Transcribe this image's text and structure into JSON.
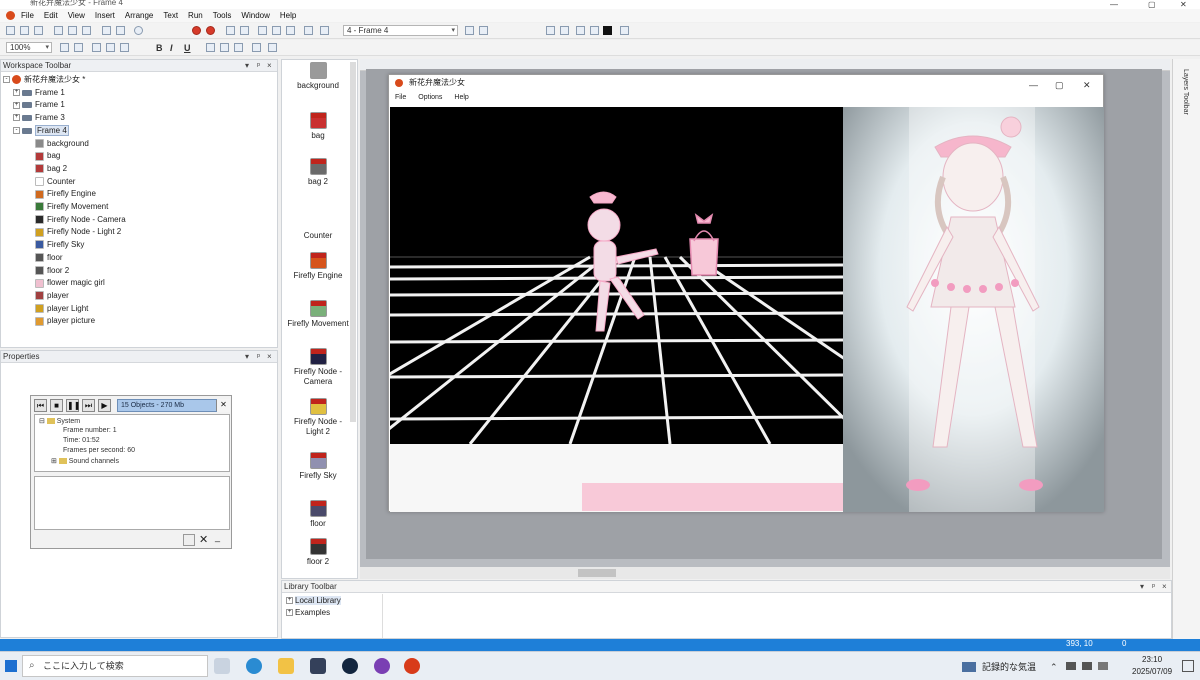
{
  "window": {
    "title": "新花弁魔法少女 - Frame 4"
  },
  "menu": [
    "File",
    "Edit",
    "View",
    "Insert",
    "Arrange",
    "Text",
    "Run",
    "Tools",
    "Window",
    "Help"
  ],
  "toolbar": {
    "frame_select": "4 - Frame 4",
    "zoom_select": "100%",
    "bold": "B",
    "italic": "I",
    "underline": "U"
  },
  "workspace": {
    "title": "Workspace Toolbar",
    "app_name": "新花弁魔法少女 *",
    "frames": [
      "Frame 1",
      "Frame 1",
      "Frame 3",
      "Frame 4"
    ],
    "objects": [
      {
        "label": "background",
        "color": "#8a8a8a"
      },
      {
        "label": "bag",
        "color": "#b33a3a"
      },
      {
        "label": "bag 2",
        "color": "#b33a3a"
      },
      {
        "label": "Counter",
        "color": "#ffffff"
      },
      {
        "label": "Firefly Engine",
        "color": "#d06a1f"
      },
      {
        "label": "Firefly Movement",
        "color": "#3a7a3a"
      },
      {
        "label": "Firefly Node - Camera",
        "color": "#2a2a2a"
      },
      {
        "label": "Firefly Node - Light 2",
        "color": "#d0a020"
      },
      {
        "label": "Firefly Sky",
        "color": "#3a5aa0"
      },
      {
        "label": "floor",
        "color": "#555555"
      },
      {
        "label": "floor 2",
        "color": "#555555"
      },
      {
        "label": "flower magic girl",
        "color": "#f0c0d0"
      },
      {
        "label": "player",
        "color": "#a04040"
      },
      {
        "label": "player Light",
        "color": "#d0a020"
      },
      {
        "label": "player picture",
        "color": "#e09a30"
      }
    ]
  },
  "properties": {
    "title": "Properties"
  },
  "frame_objects": [
    {
      "label": "background",
      "color": "#9a9a9a",
      "firefly": false
    },
    {
      "label": "bag",
      "color": "#c93030",
      "firefly": true
    },
    {
      "label": "bag 2",
      "color": "#6a6a6a",
      "firefly": true
    },
    {
      "label": "Counter",
      "color": "#ffffff",
      "firefly": false
    },
    {
      "label": "Firefly Engine",
      "color": "#d6541c",
      "firefly": true
    },
    {
      "label": "Firefly Movement",
      "color": "#7ab07a",
      "firefly": true
    },
    {
      "label": "Firefly Node -\nCamera",
      "color": "#222244",
      "firefly": true
    },
    {
      "label": "Firefly Node -\nLight 2",
      "color": "#e0c040",
      "firefly": true
    },
    {
      "label": "Firefly Sky",
      "color": "#9090b0",
      "firefly": true
    },
    {
      "label": "floor",
      "color": "#4a4a6a",
      "firefly": true
    },
    {
      "label": "floor 2",
      "color": "#333333",
      "firefly": true
    }
  ],
  "debugger": {
    "info": "15 Objects - 270 Mb",
    "tree": [
      "System",
      "Frame number: 1",
      "Time: 01:52",
      "Frames per second: 60",
      "Sound channels"
    ]
  },
  "game": {
    "title": "新花弁魔法少女",
    "menu": [
      "File",
      "Options",
      "Help"
    ]
  },
  "library": {
    "title": "Library Toolbar",
    "items": [
      "Local Library",
      "Examples"
    ]
  },
  "side_tab": "Layers Toolbar",
  "status": {
    "coords": "393, 10",
    "layer": "0"
  },
  "taskbar": {
    "search_placeholder": "ここに入力して検索",
    "weather": "記録的な気温",
    "time": "23:10",
    "date": "2025/07/09"
  }
}
